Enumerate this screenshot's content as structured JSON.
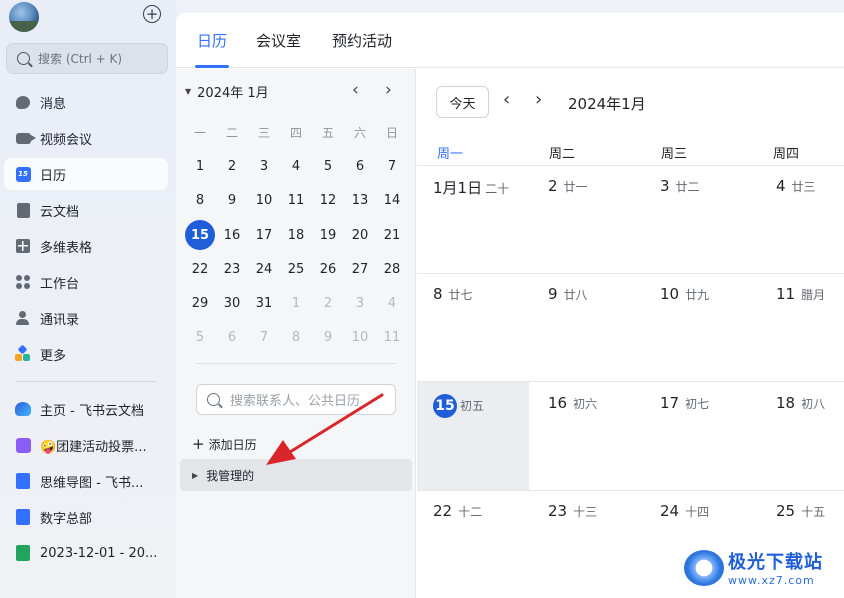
{
  "sidebar": {
    "search_placeholder": "搜索 (Ctrl + K)",
    "primary_items": [
      {
        "label": "消息",
        "icon": "message-icon"
      },
      {
        "label": "视频会议",
        "icon": "video-icon"
      },
      {
        "label": "日历",
        "icon": "calendar-icon",
        "active": true
      },
      {
        "label": "云文档",
        "icon": "doc-icon"
      },
      {
        "label": "多维表格",
        "icon": "base-icon"
      },
      {
        "label": "工作台",
        "icon": "workplace-icon"
      },
      {
        "label": "通讯录",
        "icon": "contacts-icon"
      },
      {
        "label": "更多",
        "icon": "more-icon"
      }
    ],
    "pinned_items": [
      {
        "label": "主页 - 飞书云文档",
        "icon": "wiki-icon"
      },
      {
        "label": "🤪团建活动投票...",
        "icon": "form-icon"
      },
      {
        "label": "思维导图 - 飞书...",
        "icon": "mindmap-icon"
      },
      {
        "label": "数字总部",
        "icon": "base-doc-icon"
      },
      {
        "label": "2023-12-01 - 20...",
        "icon": "sheet-icon"
      }
    ]
  },
  "tabs": [
    "日历",
    "会议室",
    "预约活动"
  ],
  "mini_calendar": {
    "month_label": "2024年 1月",
    "weekdays": [
      "一",
      "二",
      "三",
      "四",
      "五",
      "六",
      "日"
    ],
    "weeks": [
      [
        "1",
        "2",
        "3",
        "4",
        "5",
        "6",
        "7"
      ],
      [
        "8",
        "9",
        "10",
        "11",
        "12",
        "13",
        "14"
      ],
      [
        "15",
        "16",
        "17",
        "18",
        "19",
        "20",
        "21"
      ],
      [
        "22",
        "23",
        "24",
        "25",
        "26",
        "27",
        "28"
      ],
      [
        "29",
        "30",
        "31",
        "1",
        "2",
        "3",
        "4"
      ],
      [
        "5",
        "6",
        "7",
        "8",
        "9",
        "10",
        "11"
      ]
    ],
    "today": "15",
    "contact_search_placeholder": "搜索联系人、公共日历",
    "add_calendar_label": "添加日历",
    "managed_label": "我管理的"
  },
  "week_view": {
    "today_button": "今天",
    "title": "2024年1月",
    "day_headers": [
      "周一",
      "周二",
      "周三",
      "周四"
    ],
    "rows": [
      [
        {
          "d": "1月1日",
          "l": "二十"
        },
        {
          "d": "2",
          "l": "廿一"
        },
        {
          "d": "3",
          "l": "廿二"
        },
        {
          "d": "4",
          "l": "廿三"
        }
      ],
      [
        {
          "d": "8",
          "l": "廿七"
        },
        {
          "d": "9",
          "l": "廿八"
        },
        {
          "d": "10",
          "l": "廿九"
        },
        {
          "d": "11",
          "l": "腊月"
        }
      ],
      [
        {
          "d": "15",
          "l": "初五"
        },
        {
          "d": "16",
          "l": "初六"
        },
        {
          "d": "17",
          "l": "初七"
        },
        {
          "d": "18",
          "l": "初八"
        }
      ],
      [
        {
          "d": "22",
          "l": "十二"
        },
        {
          "d": "23",
          "l": "十三"
        },
        {
          "d": "24",
          "l": "十四"
        },
        {
          "d": "25",
          "l": "十五"
        }
      ]
    ]
  },
  "watermark": {
    "title": "极光下载站",
    "url": "www.xz7.com"
  },
  "colors": {
    "accent": "#3370ff",
    "today": "#1f5ed8",
    "arrow": "#d9262a"
  }
}
